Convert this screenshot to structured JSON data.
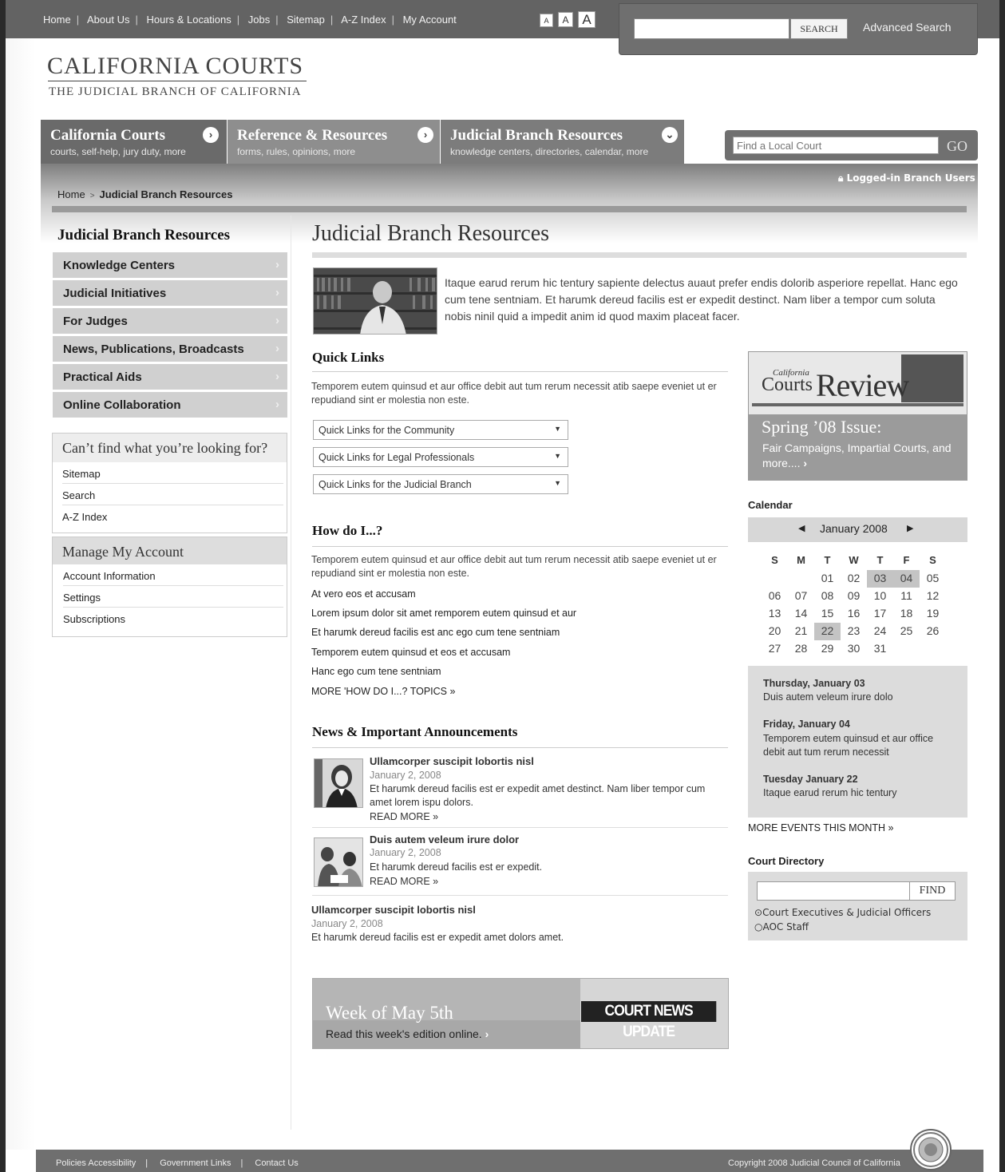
{
  "topnav": {
    "links": [
      "Home",
      "About Us",
      "Hours & Locations",
      "Jobs",
      "Sitemap",
      "A-Z Index",
      "My Account"
    ],
    "font_sizes": [
      "A",
      "A",
      "A"
    ],
    "search_button": "SEARCH",
    "advanced_search": "Advanced Search"
  },
  "logo": {
    "title": "CALIFORNIA COURTS",
    "subtitle": "THE JUDICIAL BRANCH OF CALIFORNIA"
  },
  "tabs": [
    {
      "title": "California Courts",
      "sub": "courts, self-help, jury duty, more"
    },
    {
      "title": "Reference & Resources",
      "sub": "forms, rules, opinions, more"
    },
    {
      "title": "Judicial Branch Resources",
      "sub": "knowledge centers, directories, calendar, more"
    }
  ],
  "find_court": {
    "placeholder": "Find a Local Court",
    "go": "GO"
  },
  "breadcrumb": {
    "home": "Home",
    "current": "Judicial Branch Resources"
  },
  "logged_in": "Logged-in Branch Users",
  "sidebar": {
    "heading": "Judicial Branch Resources",
    "items": [
      "Knowledge Centers",
      "Judicial Initiatives",
      "For Judges",
      "News, Publications, Broadcasts",
      "Practical Aids",
      "Online Collaboration"
    ],
    "cant_find": {
      "heading": "Can’t find what you’re looking for?",
      "links": [
        "Sitemap",
        "Search",
        "A-Z Index"
      ]
    },
    "account": {
      "heading": "Manage My Account",
      "links": [
        "Account Information",
        "Settings",
        "Subscriptions"
      ]
    }
  },
  "main": {
    "title": "Judicial Branch Resources",
    "intro": "Itaque earud rerum hic tentury sapiente delectus auaut prefer endis dolorib asperiore repellat. Hanc ego cum tene sentniam. Et harumk dereud facilis est er expedit destinct. Nam liber a tempor cum soluta nobis ninil quid a impedit anim id quod maxim placeat facer.",
    "quick_links": {
      "heading": "Quick Links",
      "text": "Temporem eutem quinsud et aur office debit aut tum rerum necessit atib saepe eveniet ut er repudiand sint er molestia non este.",
      "selects": [
        "Quick Links for the Community",
        "Quick Links for Legal Professionals",
        "Quick Links for the Judicial Branch"
      ]
    },
    "how_do_i": {
      "heading": "How do I...?",
      "text": "Temporem eutem quinsud et aur office debit aut tum rerum necessit atib saepe eveniet ut er repudiand sint er molestia non este.",
      "links": [
        "At vero eos et accusam",
        "Lorem ipsum dolor sit amet remporem eutem quinsud et aur",
        "Et harumk dereud facilis est anc ego cum tene sentniam",
        "Temporem eutem quinsud et eos et accusam",
        "Hanc ego cum tene sentniam"
      ],
      "more": "MORE 'HOW DO I...? TOPICS »"
    },
    "news": {
      "heading": "News & Important Announcements",
      "items": [
        {
          "title": "Ullamcorper suscipit lobortis nisl",
          "date": "January 2, 2008",
          "text": "Et harumk dereud facilis est er expedit amet destinct. Nam liber  tempor cum amet lorem ispu dolors.",
          "more": "READ MORE »"
        },
        {
          "title": "Duis autem veleum irure dolor",
          "date": "January 2, 2008",
          "text": "Et harumk dereud facilis est er expedit.",
          "more": "READ MORE »"
        },
        {
          "title": "Ullamcorper suscipit lobortis nisl",
          "date": "January 2, 2008",
          "text": "Et harumk dereud facilis est er expedit amet dolors amet."
        }
      ]
    },
    "promo": {
      "headline": "Week of May 5th",
      "sub": "Read this week's edition online.",
      "badge": "COURT NEWS UPDATE"
    }
  },
  "right": {
    "review": {
      "masthead1": "California",
      "masthead2": "Courts",
      "masthead3": "Review",
      "issue": "Spring ’08 Issue:",
      "desc": "Fair Campaigns, Impartial Courts, and more...."
    },
    "calendar": {
      "heading": "Calendar",
      "month": "January 2008",
      "dow": [
        "S",
        "M",
        "T",
        "W",
        "T",
        "F",
        "S"
      ],
      "weeks": [
        [
          "",
          "",
          "01",
          "02",
          "03",
          "04",
          "05"
        ],
        [
          "06",
          "07",
          "08",
          "09",
          "10",
          "11",
          "12"
        ],
        [
          "13",
          "14",
          "15",
          "16",
          "17",
          "18",
          "19"
        ],
        [
          "20",
          "21",
          "22",
          "23",
          "24",
          "25",
          "26"
        ],
        [
          "27",
          "28",
          "29",
          "30",
          "31",
          "",
          ""
        ]
      ],
      "highlighted": [
        "03",
        "04",
        "22"
      ]
    },
    "events": [
      {
        "title": "Thursday, January 03",
        "text": "Duis autem veleum irure dolo"
      },
      {
        "title": "Friday, January 04",
        "text": "Temporem eutem quinsud et aur office debit aut tum rerum necessit"
      },
      {
        "title": "Tuesday January 22",
        "text": "Itaque earud rerum hic tentury"
      }
    ],
    "more_events": "MORE EVENTS THIS MONTH »",
    "directory": {
      "heading": "Court Directory",
      "find": "FIND",
      "options": [
        "Court Executives & Judicial Officers",
        "AOC Staff"
      ]
    }
  },
  "footer": {
    "links": [
      "Policies Accessibility",
      "Government Links",
      "Contact Us"
    ],
    "copyright": "Copyright 2008 Judicial Council of California"
  }
}
